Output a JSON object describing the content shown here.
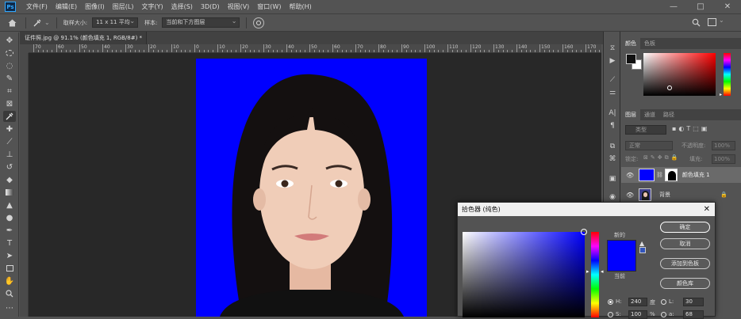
{
  "app": {
    "logo": "Ps"
  },
  "menu": [
    "文件(F)",
    "编辑(E)",
    "图像(I)",
    "图层(L)",
    "文字(Y)",
    "选择(S)",
    "3D(D)",
    "视图(V)",
    "窗口(W)",
    "帮助(H)"
  ],
  "window_controls": {
    "minimize": "—",
    "maximize": "□",
    "close": "✕"
  },
  "options": {
    "sample_size_label": "取样大小:",
    "sample_size_value": "11 x 11 平均",
    "sample_label": "样本:",
    "sample_value": "当前和下方图层"
  },
  "document": {
    "tab_title": "证件照.jpg @ 91.1% (颜色填充 1, RGB/8#) *",
    "close": "×"
  },
  "ruler": {
    "top_labels": [
      "70",
      "60",
      "50",
      "40",
      "30",
      "20",
      "10",
      "0",
      "10",
      "20",
      "30",
      "40",
      "50",
      "60",
      "70",
      "80",
      "90",
      "100",
      "110",
      "120",
      "130",
      "140",
      "150",
      "160",
      "170"
    ]
  },
  "panels": {
    "color_tabs": [
      "颜色",
      "色板"
    ],
    "layers_tabs": [
      "图层",
      "通道",
      "路径"
    ],
    "kind_placeholder": "类型",
    "blend_mode": "正常",
    "opacity_label": "不透明度:",
    "opacity_value": "100%",
    "lock_label": "锁定:",
    "fill_label": "填充:",
    "fill_value": "100%",
    "layers": [
      {
        "name": "颜色填充 1"
      },
      {
        "name": "背景"
      }
    ]
  },
  "picker": {
    "title": "拾色器 (纯色)",
    "close": "✕",
    "new_label": "新的",
    "current_label": "当前",
    "buttons": {
      "ok": "确定",
      "cancel": "取消",
      "add_swatch": "添加到色板",
      "libraries": "颜色库"
    },
    "fields": {
      "h_label": "H:",
      "h_value": "240",
      "h_unit": "度",
      "s_label": "S:",
      "s_value": "100",
      "s_unit": "%",
      "l_label": "L:",
      "l_value": "30",
      "a_label": "a:",
      "a_value": "68"
    },
    "new_color": "#0000ff",
    "current_color": "#0000ff"
  }
}
